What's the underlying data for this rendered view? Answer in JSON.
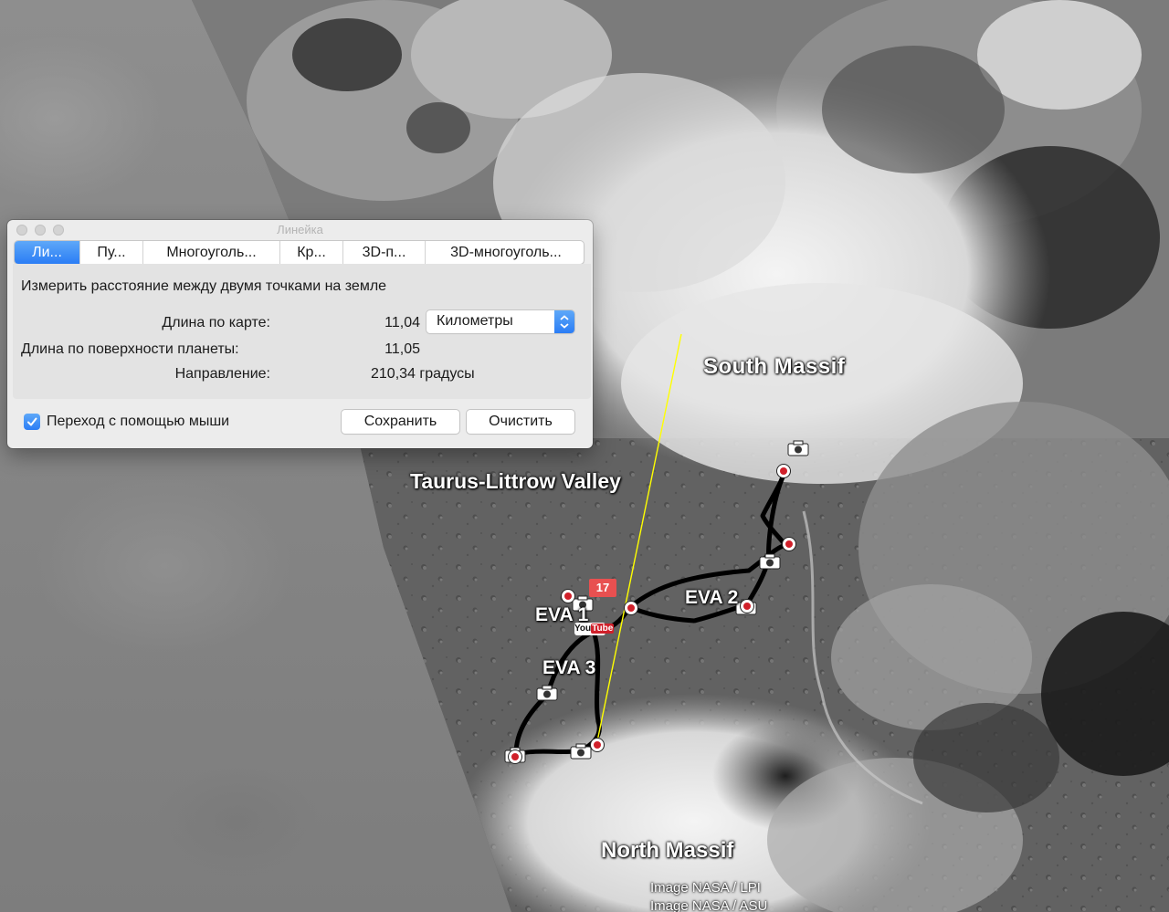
{
  "window": {
    "title": "Линейка"
  },
  "tabs": [
    {
      "label": "Ли...",
      "active": true
    },
    {
      "label": "Пу...",
      "active": false
    },
    {
      "label": "Многоуголь...",
      "active": false
    },
    {
      "label": "Кр...",
      "active": false
    },
    {
      "label": "3D-п...",
      "active": false
    },
    {
      "label": "3D-многоуголь...",
      "active": false
    }
  ],
  "panel": {
    "description": "Измерить расстояние между двумя точками на земле",
    "map_length_label": "Длина по карте:",
    "map_length_value": "11,04",
    "unit_selected": "Километры",
    "surface_length_label": "Длина по поверхности планеты:",
    "surface_length_value": "11,05",
    "direction_label": "Направление:",
    "direction_value": "210,34 градусы"
  },
  "footer": {
    "mouse_nav_label": "Переход с помощью мыши",
    "mouse_nav_checked": true,
    "save_label": "Сохранить",
    "clear_label": "Очистить"
  },
  "map": {
    "labels": {
      "south_massif": "South Massif",
      "valley": "Taurus-Littrow Valley",
      "north_massif": "North Massif",
      "eva1": "EVA 1",
      "eva2": "EVA 2",
      "eva3": "EVA 3"
    },
    "badge": "17",
    "youtube_label": "You",
    "youtube_tube": "Tube",
    "credits": [
      "Image NASA / LPI",
      "Image NASA / ASU"
    ],
    "colors": {
      "ruler_line": "#ffff00",
      "traverse": "#000000",
      "accent": "#2b7df5"
    }
  }
}
